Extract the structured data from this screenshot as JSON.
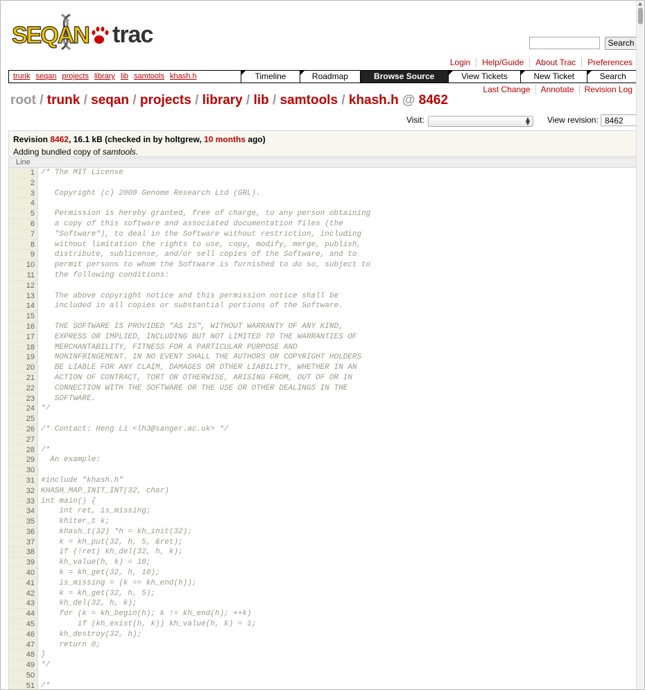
{
  "search": {
    "button": "Search",
    "value": ""
  },
  "metanav": [
    "Login",
    "Help/Guide",
    "About Trac",
    "Preferences"
  ],
  "mainnav": {
    "crumbs": [
      "trunk",
      "seqan",
      "projects",
      "library",
      "lib",
      "samtools",
      "khash.h"
    ],
    "items": [
      "Timeline",
      "Roadmap",
      "Browse Source",
      "View Tickets",
      "New Ticket",
      "Search"
    ]
  },
  "ctxnav": [
    "Last Change",
    "Annotate",
    "Revision Log"
  ],
  "path": {
    "root": "root",
    "segments": [
      "trunk",
      "seqan",
      "projects",
      "library",
      "lib",
      "samtools",
      "khash.h"
    ],
    "rev": "8462"
  },
  "visit": {
    "label": "Visit:",
    "value": ""
  },
  "view_revision": {
    "label": "View revision:",
    "value": "8462"
  },
  "info": {
    "revision_label": "Revision",
    "revision": "8462",
    "size_text": ", 16.1 kB (checked in by holtgrew,",
    "age": "10 months",
    "age_suffix": "ago)",
    "message_prefix": "Adding bundled copy of ",
    "message_em": "samtools",
    "message_suffix": "."
  },
  "code_header": "Line",
  "lines": [
    "/* The MIT License",
    "",
    "   Copyright (c) 2008 Genome Research Ltd (GRL).",
    "",
    "   Permission is hereby granted, free of charge, to any person obtaining",
    "   a copy of this software and associated documentation files (the",
    "   \"Software\"), to deal in the Software without restriction, including",
    "   without limitation the rights to use, copy, modify, merge, publish,",
    "   distribute, sublicense, and/or sell copies of the Software, and to",
    "   permit persons to whom the Software is furnished to do so, subject to",
    "   the following conditions:",
    "",
    "   The above copyright notice and this permission notice shall be",
    "   included in all copies or substantial portions of the Software.",
    "",
    "   THE SOFTWARE IS PROVIDED \"AS IS\", WITHOUT WARRANTY OF ANY KIND,",
    "   EXPRESS OR IMPLIED, INCLUDING BUT NOT LIMITED TO THE WARRANTIES OF",
    "   MERCHANTABILITY, FITNESS FOR A PARTICULAR PURPOSE AND",
    "   NONINFRINGEMENT. IN NO EVENT SHALL THE AUTHORS OR COPYRIGHT HOLDERS",
    "   BE LIABLE FOR ANY CLAIM, DAMAGES OR OTHER LIABILITY, WHETHER IN AN",
    "   ACTION OF CONTRACT, TORT OR OTHERWISE, ARISING FROM, OUT OF OR IN",
    "   CONNECTION WITH THE SOFTWARE OR THE USE OR OTHER DEALINGS IN THE",
    "   SOFTWARE.",
    "*/",
    "",
    "/* Contact: Heng Li <lh3@sanger.ac.uk> */",
    "",
    "/*",
    "  An example:",
    "",
    "#include \"khash.h\"",
    "KHASH_MAP_INIT_INT(32, char)",
    "int main() {",
    "    int ret, is_missing;",
    "    khiter_t k;",
    "    khash_t(32) *h = kh_init(32);",
    "    k = kh_put(32, h, 5, &ret);",
    "    if (!ret) kh_del(32, h, k);",
    "    kh_value(h, k) = 10;",
    "    k = kh_get(32, h, 10);",
    "    is_missing = (k == kh_end(h));",
    "    k = kh_get(32, h, 5);",
    "    kh_del(32, h, k);",
    "    for (k = kh_begin(h); k != kh_end(h); ++k)",
    "        if (kh_exist(h, k)) kh_value(h, k) = 1;",
    "    kh_destroy(32, h);",
    "    return 0;",
    "}",
    "*/",
    "",
    "/*"
  ]
}
